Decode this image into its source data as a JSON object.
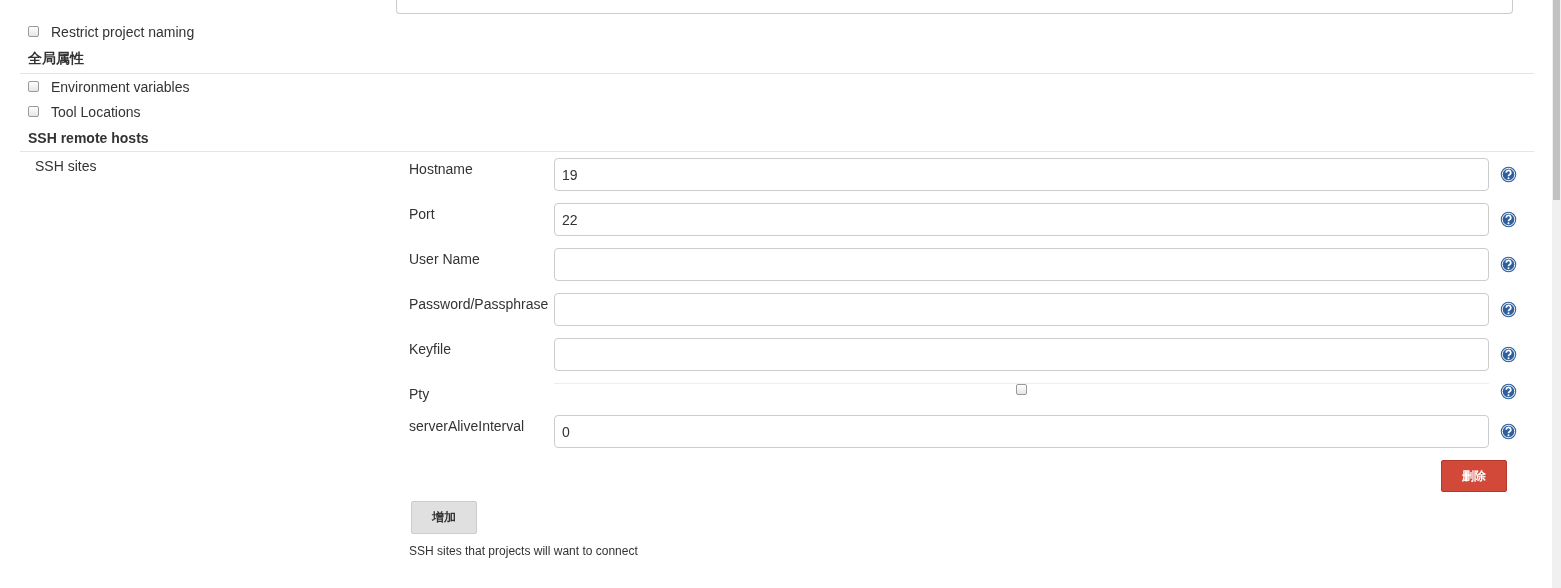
{
  "top_checkboxes": [
    {
      "label": "Restrict project naming",
      "checked": false
    }
  ],
  "sections": [
    {
      "title": "全局属性",
      "checkboxes": [
        {
          "label": "Environment variables",
          "checked": false
        },
        {
          "label": "Tool Locations",
          "checked": false
        }
      ]
    },
    {
      "title": "SSH remote hosts"
    }
  ],
  "ssh_sites": {
    "label": "SSH sites",
    "fields": [
      {
        "kind": "text",
        "label": "Hostname",
        "value": "19"
      },
      {
        "kind": "text",
        "label": "Port",
        "value": "22"
      },
      {
        "kind": "text",
        "label": "User Name"
      },
      {
        "kind": "text",
        "label": "Password/Passphrase"
      },
      {
        "kind": "text",
        "label": "Keyfile"
      },
      {
        "kind": "checkbox",
        "label": "Pty",
        "checked": false
      },
      {
        "kind": "text",
        "label": "serverAliveInterval",
        "value": "0"
      }
    ],
    "delete_button": "删除",
    "add_button": "增加",
    "description": "SSH sites that projects will want to connect"
  }
}
